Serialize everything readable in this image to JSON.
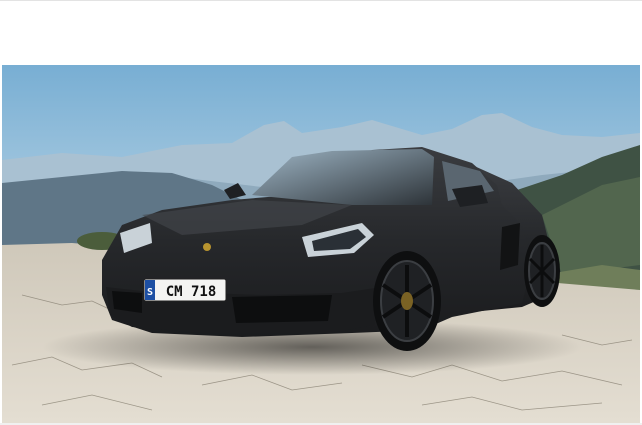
{
  "photo": {
    "license_plate": {
      "country_code": "S",
      "number": "CM 718"
    },
    "colors": {
      "sky_top": "#7fb2d6",
      "sky_bottom": "#dbeaf3",
      "car_body": "#2b2d30",
      "ground": "#d9d3c7"
    }
  }
}
